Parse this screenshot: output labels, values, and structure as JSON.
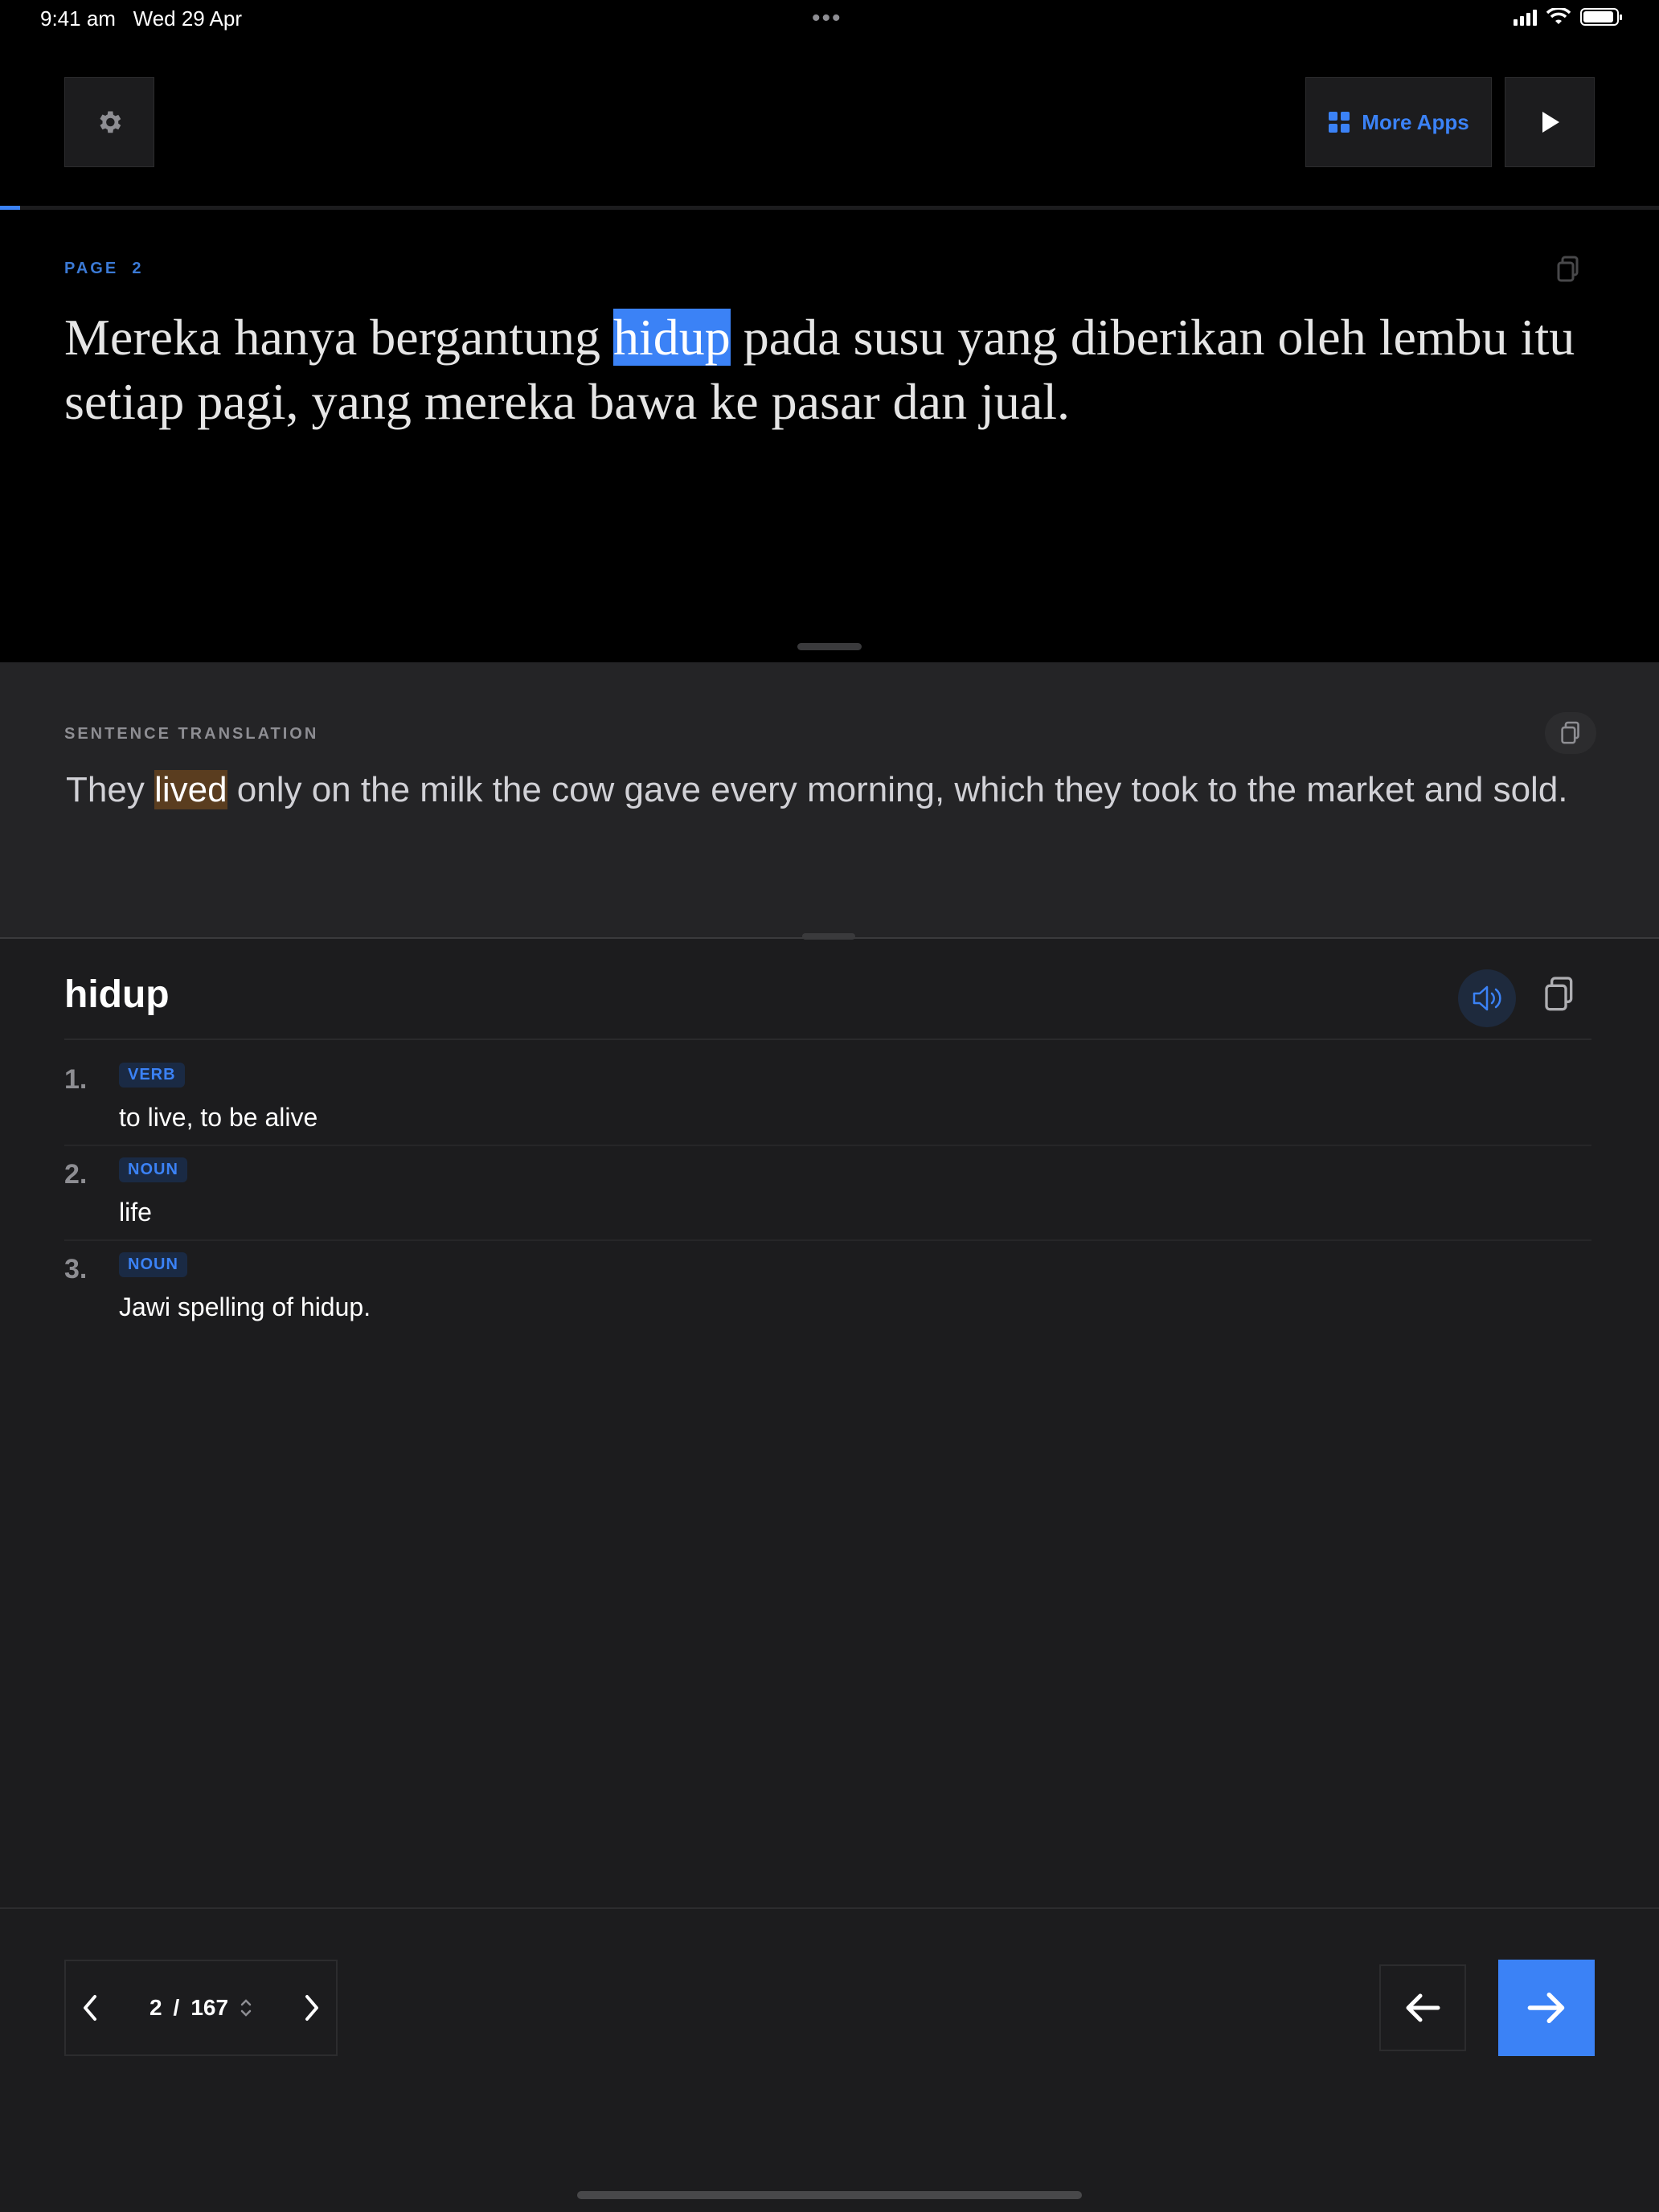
{
  "status_bar": {
    "time": "9:41 am",
    "date": "Wed 29 Apr",
    "dots": "•••",
    "battery_level": 0.92
  },
  "toolbar": {
    "settings_icon": "gear-icon",
    "more_apps_label": "More Apps",
    "more_apps_icon": "grid-icon",
    "play_icon": "play-icon",
    "progress_fraction": 0.012
  },
  "page": {
    "label": "PAGE",
    "number": "2",
    "sentence_before": "Mereka hanya bergantung ",
    "sentence_highlight": "hidup",
    "sentence_after": " pada susu yang diberikan oleh lembu itu setiap pagi, yang mereka bawa ke pasar dan jual."
  },
  "translation": {
    "label": "SENTENCE TRANSLATION",
    "before": "They ",
    "highlight": "lived",
    "after": " only on the milk the cow gave every morning, which they took to the market and sold."
  },
  "dictionary": {
    "word": "hidup",
    "definitions": [
      {
        "num": "1.",
        "pos": "VERB",
        "gloss": "to live, to be alive"
      },
      {
        "num": "2.",
        "pos": "NOUN",
        "gloss": "life"
      },
      {
        "num": "3.",
        "pos": "NOUN",
        "gloss": "Jawi spelling of hidup."
      }
    ]
  },
  "pager": {
    "current": "2",
    "separator": "/",
    "total": "167"
  },
  "colors": {
    "accent": "#3b82f6",
    "highlight_translation": "#5a3d1f"
  }
}
